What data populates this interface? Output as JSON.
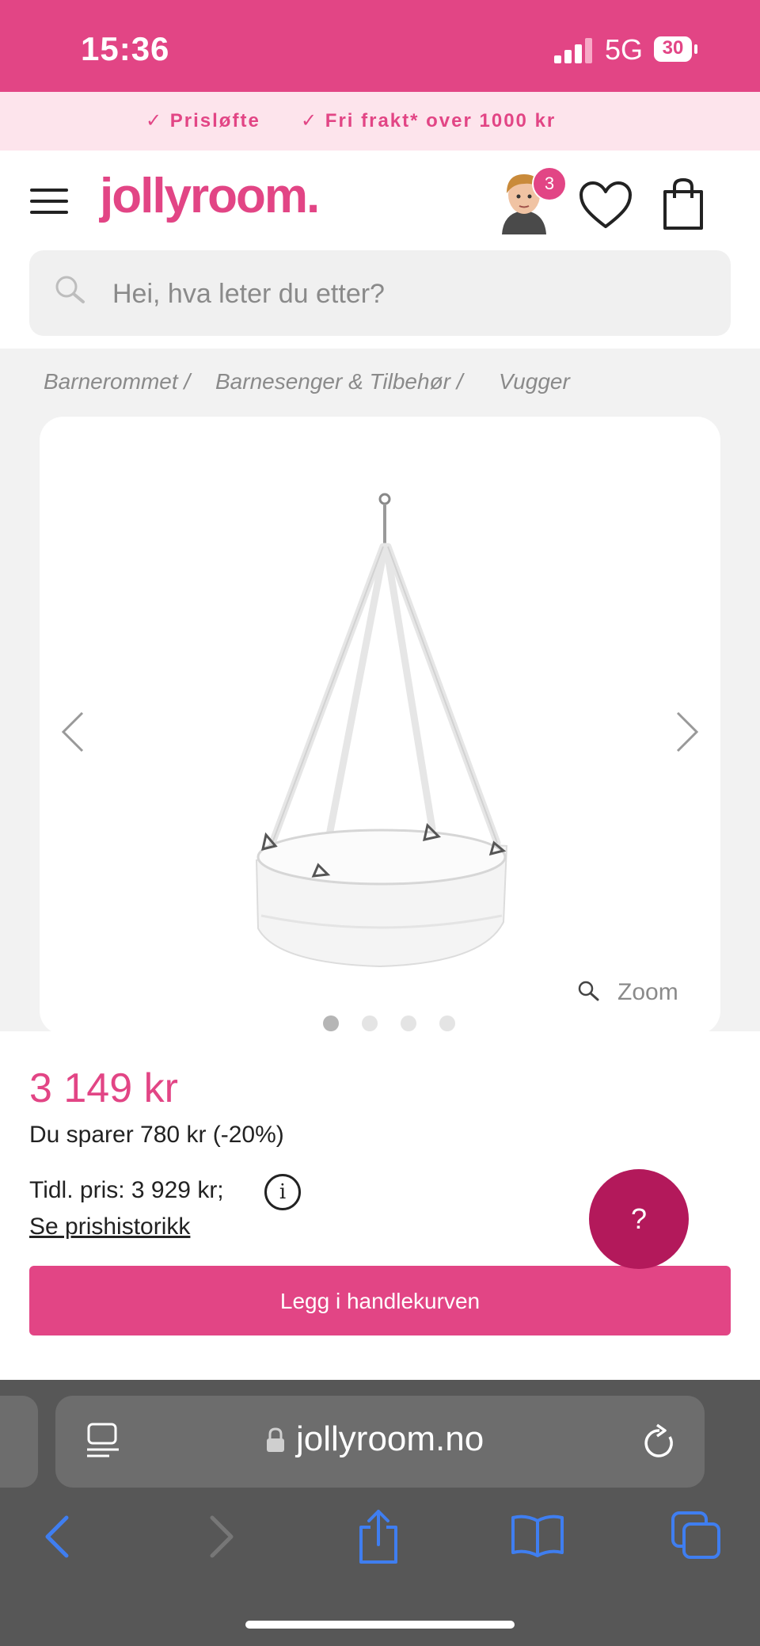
{
  "status_bar": {
    "time": "15:36",
    "network": "5G",
    "battery": "30"
  },
  "promo": {
    "items": [
      "✓ Prisløfte",
      "✓ Fri frakt* over 1000 kr"
    ]
  },
  "header": {
    "logo": "jollyroom.",
    "avatar_badge": "3"
  },
  "search": {
    "placeholder": "Hei, hva leter du etter?"
  },
  "breadcrumb": [
    "Barnerommet /",
    "Barnesenger & Tilbehør /",
    "Vugger"
  ],
  "gallery": {
    "zoom_label": "Zoom",
    "dot_count": 4,
    "active_dot": 0
  },
  "product": {
    "price": "3 149 kr",
    "savings": "Du sparer 780 kr (-20%)",
    "previous_price": "Tidl. pris: 3 929 kr;",
    "price_history_link": "Se prishistorikk",
    "info_glyph": "i",
    "help_glyph": "?",
    "add_to_cart": "Legg i handlekurven"
  },
  "browser": {
    "url": "jollyroom.no"
  },
  "colors": {
    "brand": "#e24585",
    "brand_dark": "#b3195b",
    "safari_bg": "#575757",
    "ios_blue": "#3f7ef0"
  }
}
